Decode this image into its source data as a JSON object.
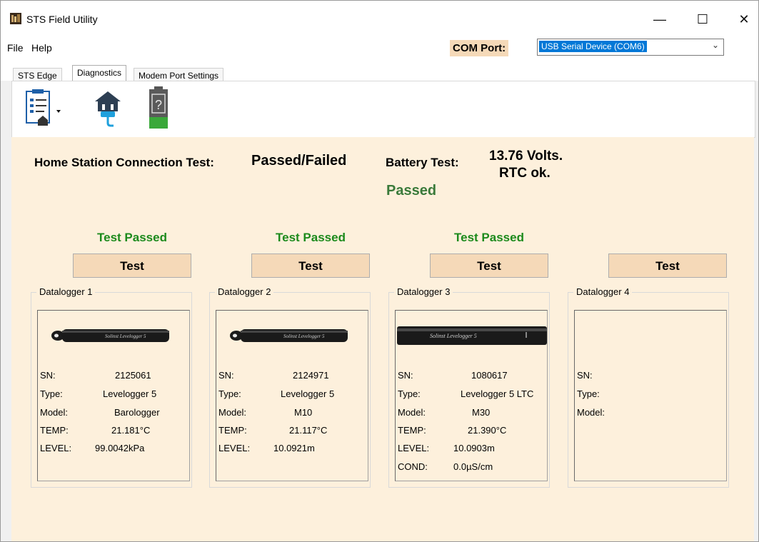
{
  "window": {
    "title": "STS Field Utility",
    "minimize": "—",
    "maximize": "☐",
    "close": "✕"
  },
  "menu": {
    "file": "File",
    "help": "Help"
  },
  "com_port": {
    "label": "COM Port:",
    "value": "USB Serial Device (COM6)"
  },
  "tabs": [
    "STS Edge",
    "Diagnostics",
    "Modem Port Settings"
  ],
  "toolbar": {
    "icons": [
      "report-icon",
      "home-station-plug-icon",
      "battery-icon"
    ],
    "battery_glyph": "?"
  },
  "diagnostics": {
    "home_station_label": "Home Station Connection Test:",
    "home_station_result": "Passed/Failed",
    "battery_label": "Battery Test:",
    "battery_voltage": "13.76 Volts.",
    "battery_rtc": "RTC ok.",
    "battery_result": "Passed"
  },
  "colors": {
    "pass_green": "#1c8a1c",
    "button_tan": "#f5d9b8",
    "panel_bg": "#fdf0dc"
  },
  "dataloggers": [
    {
      "status": "Test Passed",
      "button": "Test",
      "title": "Datalogger 1",
      "image_text": "Solinst  Levelogger 5",
      "fields": [
        {
          "label": "SN:",
          "value": "2125061"
        },
        {
          "label": "Type:",
          "value": "Levelogger 5"
        },
        {
          "label": "Model:",
          "value": "Barologger"
        },
        {
          "label": "TEMP:",
          "value": "21.181°C"
        },
        {
          "label": "LEVEL:",
          "value": "99.0042kPa"
        }
      ]
    },
    {
      "status": "Test Passed",
      "button": "Test",
      "title": "Datalogger 2",
      "image_text": "Solinst  Levelogger 5",
      "fields": [
        {
          "label": "SN:",
          "value": "2124971"
        },
        {
          "label": "Type:",
          "value": "Levelogger 5"
        },
        {
          "label": "Model:",
          "value": "M10"
        },
        {
          "label": "TEMP:",
          "value": "21.117°C"
        },
        {
          "label": "LEVEL:",
          "value": "10.0921m"
        }
      ]
    },
    {
      "status": "Test Passed",
      "button": "Test",
      "title": "Datalogger 3",
      "image_text": "Solinst  Levelogger 5",
      "fields": [
        {
          "label": "SN:",
          "value": "1080617"
        },
        {
          "label": "Type:",
          "value": "Levelogger 5 LTC"
        },
        {
          "label": "Model:",
          "value": "M30"
        },
        {
          "label": "TEMP:",
          "value": "21.390°C"
        },
        {
          "label": "LEVEL:",
          "value": "10.0903m"
        },
        {
          "label": "COND:",
          "value": "0.0µS/cm"
        }
      ]
    },
    {
      "status": "",
      "button": "Test",
      "title": "Datalogger 4",
      "fields": [
        {
          "label": "SN:",
          "value": ""
        },
        {
          "label": "Type:",
          "value": ""
        },
        {
          "label": "Model:",
          "value": ""
        }
      ]
    }
  ]
}
